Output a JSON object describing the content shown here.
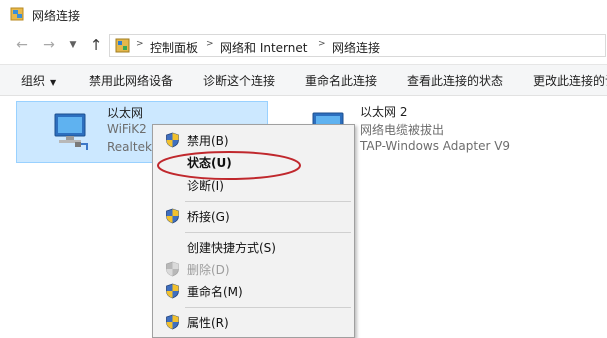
{
  "window": {
    "title": "网络连接"
  },
  "address": {
    "crumbs": [
      "控制面板",
      "网络和 Internet",
      "网络连接"
    ]
  },
  "commands": {
    "organize": "组织",
    "disable_device": "禁用此网络设备",
    "diagnose": "诊断这个连接",
    "rename": "重命名此连接",
    "view_status": "查看此连接的状态",
    "change_settings": "更改此连接的设置"
  },
  "connections": [
    {
      "name": "以太网",
      "line1": "WiFiK2",
      "line2": "Realtek"
    },
    {
      "name": "以太网 2",
      "line1": "网络电缆被拔出",
      "line2": "TAP-Windows Adapter V9"
    }
  ],
  "context_menu": {
    "items": [
      {
        "label": "禁用(B)"
      },
      {
        "label": "状态(U)"
      },
      {
        "label": "诊断(I)"
      },
      {
        "label": "桥接(G)"
      },
      {
        "label": "创建快捷方式(S)"
      },
      {
        "label": "删除(D)"
      },
      {
        "label": "重命名(M)"
      },
      {
        "label": "属性(R)"
      }
    ]
  },
  "colors": {
    "selection_bg": "#cce8ff",
    "selection_border": "#99d1ff",
    "annotation": "#c0282d"
  }
}
